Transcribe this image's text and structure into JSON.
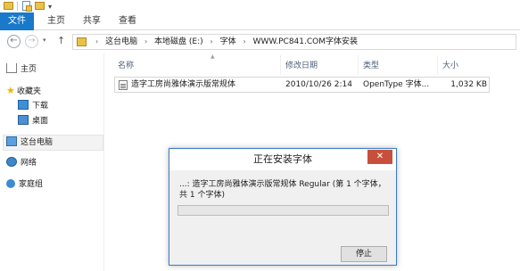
{
  "ribbon": {
    "tabs": [
      "文件",
      "主页",
      "共享",
      "查看"
    ]
  },
  "address": {
    "crumbs": [
      "这台电脑",
      "本地磁盘 (E:)",
      "字体",
      "WWW.PC841.COM字体安装"
    ]
  },
  "sidebar": {
    "items": [
      {
        "label": "主页"
      },
      {
        "label": "收藏夹"
      },
      {
        "label": "下载"
      },
      {
        "label": "桌面"
      },
      {
        "label": "这台电脑"
      },
      {
        "label": "网络"
      },
      {
        "label": "家庭组"
      }
    ]
  },
  "filelist": {
    "columns": [
      "名称",
      "修改日期",
      "类型",
      "大小"
    ],
    "rows": [
      {
        "name": "造字工房尚雅体演示版常规体",
        "modified": "2010/10/26 2:14",
        "type": "OpenType 字体...",
        "size": "1,032 KB"
      }
    ]
  },
  "dialog": {
    "title": "正在安装字体",
    "close_glyph": "✕",
    "message": "...: 造字工房尚雅体演示版常规体 Regular (第 1 个字体，共 1 个字体)",
    "progress_percent": 0,
    "stop_label": "停止"
  },
  "colors": {
    "file_tab": "#1979ca",
    "close_button": "#c7503d",
    "dialog_border": "#3a7bc8"
  }
}
